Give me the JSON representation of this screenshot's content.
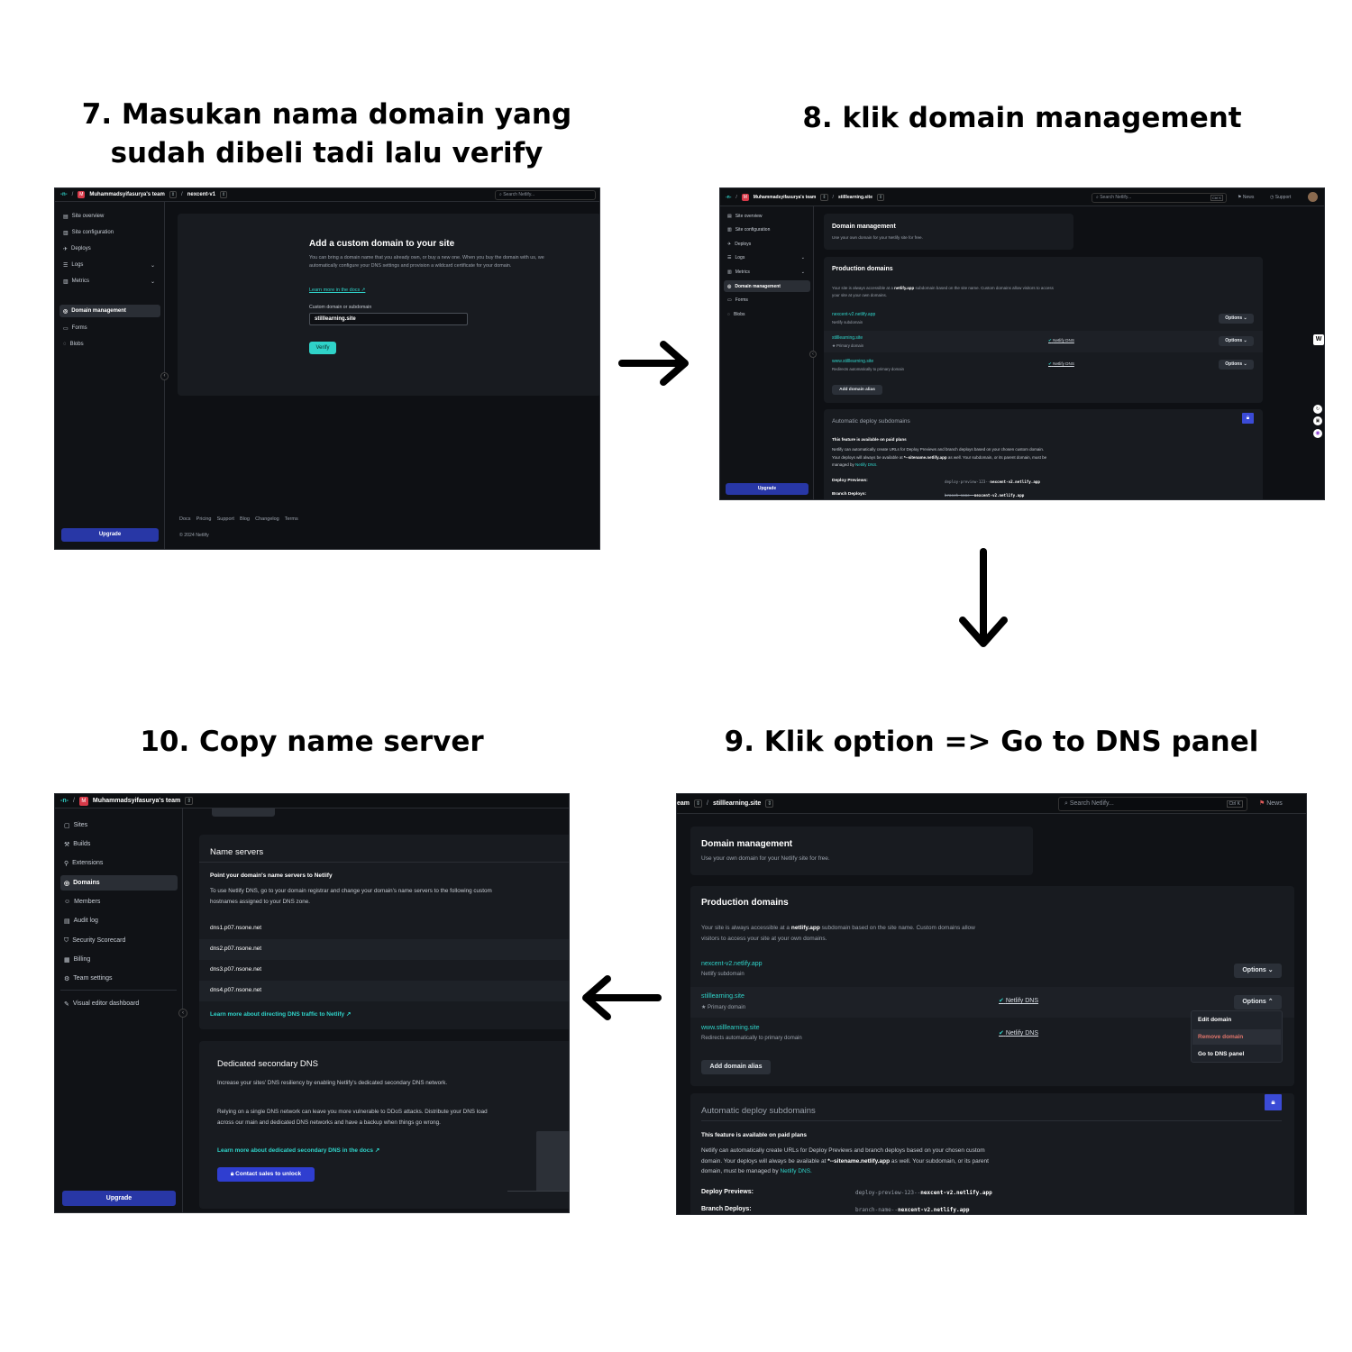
{
  "titles": {
    "t7": "7. Masukan nama domain yang sudah dibeli tadi lalu verify",
    "t8": "8. klik domain management",
    "t9": "9. Klik option => Go to DNS panel",
    "t10": "10. Copy name server"
  },
  "common": {
    "team": "Muhammadsyifasurya's team",
    "team_initial": "M",
    "logo": "-n-",
    "search": "Search Netlify...",
    "shortcut": "Ctrl K",
    "news": "News",
    "support": "Support",
    "upgrade": "Upgrade"
  },
  "s7": {
    "site": "nexcent-v1",
    "nav": [
      "Site overview",
      "Site configuration",
      "Deploys",
      "Logs",
      "Metrics",
      "Domain management",
      "Forms",
      "Blobs"
    ],
    "heading": "Add a custom domain to your site",
    "desc": "You can bring a domain name that you already own, or buy a new one. When you buy the domain with us, we automatically configure your DNS settings and provision a wildcard certificate for your domain.",
    "learn": "Learn more in the docs ↗",
    "field_label": "Custom domain or subdomain",
    "field_value": "stilllearning.site",
    "verify": "Verify",
    "footer_links": [
      "Docs",
      "Pricing",
      "Support",
      "Blog",
      "Changelog",
      "Terms"
    ],
    "copyright": "© 2024 Netlify"
  },
  "s8": {
    "site": "stilllearning.site",
    "nav": [
      "Site overview",
      "Site configuration",
      "Deploys",
      "Logs",
      "Metrics",
      "Domain management",
      "Forms",
      "Blobs"
    ]
  },
  "dm": {
    "title": "Domain management",
    "subtitle": "Use your own domain for your Netlify site for free.",
    "prod_title": "Production domains",
    "prod_desc_1": "Your site is always accessible at a ",
    "prod_desc_bold": "netlify.app",
    "prod_desc_2": " subdomain based on the site name. Custom domains allow visitors to access your site at your own domains.",
    "domains": [
      {
        "name": "nexcent-v2.netlify.app",
        "sub": "Netlify subdomain",
        "dns": ""
      },
      {
        "name": "stilllearning.site",
        "sub": "★ Primary domain",
        "dns": "Netlify DNS"
      },
      {
        "name": "www.stilllearning.site",
        "sub": "Redirects automatically to primary domain",
        "dns": "Netlify DNS"
      }
    ],
    "options": "Options",
    "add_alias": "Add domain alias",
    "auto_title": "Automatic deploy subdomains",
    "paid": "This feature is available on paid plans",
    "auto_desc_1": "Netlify can automatically create URLs for Deploy Previews and branch deploys based on your chosen custom domain. Your deploys will always be available at ",
    "auto_desc_bold": "*--sitename.netlify.app",
    "auto_desc_2": " as well. Your subdomain, or its parent domain, must be managed by ",
    "auto_desc_link": "Netlify DNS.",
    "deploy_previews_label": "Deploy Previews:",
    "deploy_previews_value_a": "deploy-preview-123--",
    "deploy_previews_value_b": "nexcent-v2.netlify.app",
    "branch_label": "Branch Deploys:",
    "branch_value_a": "branch-name--",
    "branch_value_b": "nexcent-v2.netlify.app"
  },
  "s9": {
    "team_frag": "eam",
    "site": "stilllearning.site",
    "menu": [
      "Edit domain",
      "Remove domain",
      "Go to DNS panel"
    ]
  },
  "s10": {
    "nav": [
      "Sites",
      "Builds",
      "Extensions",
      "Domains",
      "Members",
      "Audit log",
      "Security Scorecard",
      "Billing",
      "Team settings",
      "Visual editor dashboard"
    ],
    "ns_title": "Name servers",
    "ns_sub": "Point your domain's name servers to Netlify",
    "ns_desc": "To use Netlify DNS, go to your domain registrar and change your domain's name servers to the following custom hostnames assigned to your DNS zone.",
    "servers": [
      "dns1.p07.nsone.net",
      "dns2.p07.nsone.net",
      "dns3.p07.nsone.net",
      "dns4.p07.nsone.net"
    ],
    "ns_learn": "Learn more about directing DNS traffic to Netlify ↗",
    "sec_title": "Dedicated secondary DNS",
    "sec_desc1": "Increase your sites' DNS resiliency by enabling Netlify's dedicated secondary DNS network.",
    "sec_desc2": "Relying on a single DNS network can leave you more vulnerable to DDoS attacks. Distribute your DNS load across our main and dedicated DNS networks and have a backup when things go wrong.",
    "sec_learn": "Learn more about dedicated secondary DNS in the docs ↗",
    "contact": "Contact sales to unlock"
  }
}
